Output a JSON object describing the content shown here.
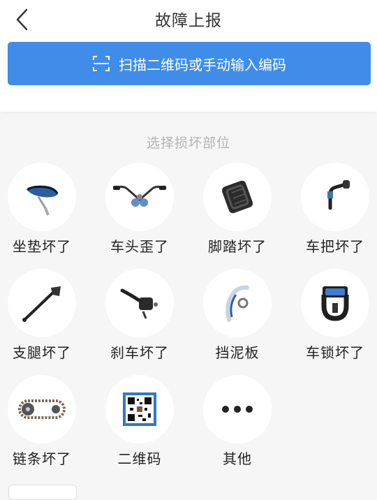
{
  "header": {
    "title": "故障上报",
    "scan_label": "扫描二维码或手动输入编码"
  },
  "section": {
    "label": "选择损坏部位"
  },
  "items": [
    {
      "label": "坐垫坏了",
      "icon": "seat-icon"
    },
    {
      "label": "车头歪了",
      "icon": "handlebar-icon"
    },
    {
      "label": "脚踏坏了",
      "icon": "pedal-icon"
    },
    {
      "label": "车把坏了",
      "icon": "grip-icon"
    },
    {
      "label": "支腿坏了",
      "icon": "kickstand-icon"
    },
    {
      "label": "刹车坏了",
      "icon": "brake-lever-icon"
    },
    {
      "label": "挡泥板",
      "icon": "fender-icon"
    },
    {
      "label": "车锁坏了",
      "icon": "lock-icon"
    },
    {
      "label": "链条坏了",
      "icon": "chain-icon"
    },
    {
      "label": "二维码",
      "icon": "qr-code-icon"
    },
    {
      "label": "其他",
      "icon": "more-icon"
    }
  ],
  "colors": {
    "accent": "#3f8de9",
    "background": "#f6f6f6"
  }
}
